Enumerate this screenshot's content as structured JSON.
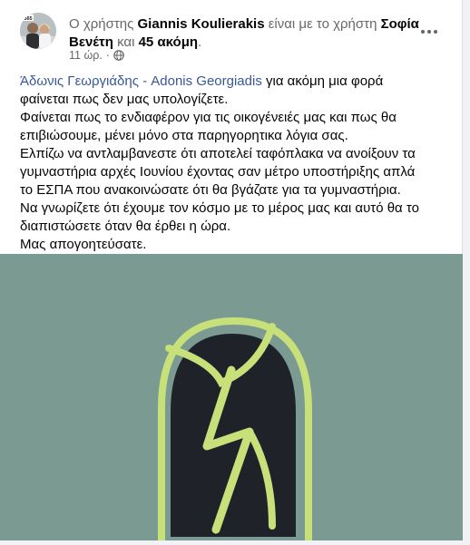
{
  "post": {
    "header": {
      "prefix": "Ο χρήστης",
      "author": "Giannis Koulierakis",
      "middle": "είναι με το χρήστη",
      "tagged_person": "Σοφία Βενέτη",
      "and": "και",
      "others": "45 ακόμη",
      "suffix": ".",
      "avatar_badge": "365"
    },
    "meta": {
      "timestamp": "11 ώρ.",
      "separator": "·",
      "privacy_icon": "globe-icon"
    },
    "more_icon": "more-horizontal-icon",
    "body": {
      "mention": "Άδωνις Γεωργιάδης - Adonis Georgiadis",
      "line1_rest": " για ακόμη μια φορά",
      "lines": [
        "φαίνεται πως δεν μας υπολογίζετε.",
        "Φαίνεται πως το ενδιαφέρον για τις οικογένειές μας και πως θα",
        "επιβιώσουμε, μένει μόνο στα παρηγορητικα λόγια σας.",
        "Ελπίζω να αντλαμβανεστε ότι αποτελεί ταφόπλακα να ανοίξουν τα",
        "γυμναστήρια αρχές Ιουνίου έχοντας σαν μέτρο υποστήριξης απλά",
        "το ΕΣΠΑ που ανακοινώσατε ότι θα βγάζατε για τα γυμναστήρια.",
        "Να γνωρίζετε ότι έχουμε τον κόσμο με το μέρος μας και αυτό θα το",
        "διαπιστώσετε  όταν θα έρθει η ώρα.",
        "Μας απογοητεύσατε."
      ]
    },
    "image": {
      "background_color": "#7a9a92",
      "logo_dark": "#20222a",
      "logo_accent": "#c7e07a"
    }
  }
}
